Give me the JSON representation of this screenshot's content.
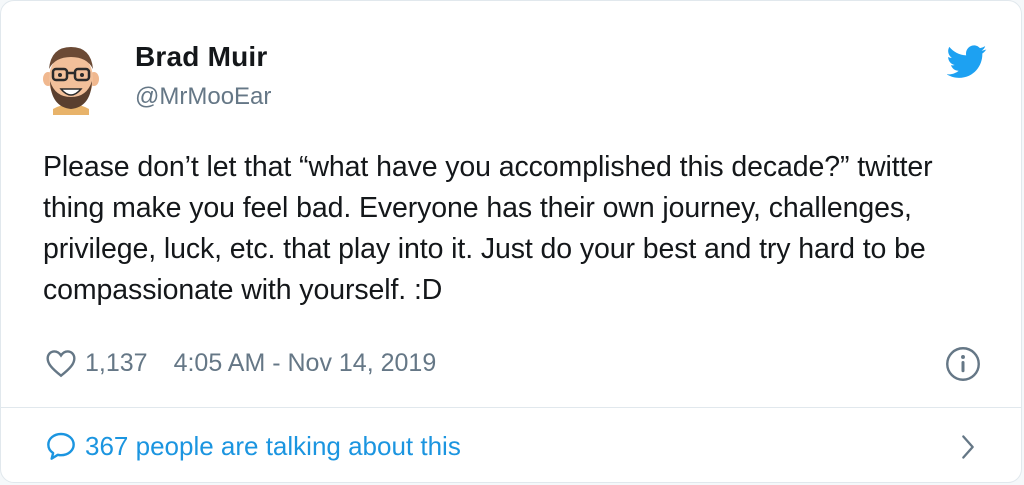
{
  "tweet": {
    "author": {
      "name": "Brad Muir",
      "handle": "@MrMooEar",
      "avatar_icon": "cartoon-avatar-bearded-man"
    },
    "text": "Please don’t let that “what have you accomplished this decade?” twitter thing make you feel bad. Everyone has their own journey, challenges, privilege, luck, etc. that play into it. Just do your best and try hard to be compassionate with yourself. :D",
    "likes": "1,137",
    "timestamp": "4:05 AM - Nov 14, 2019",
    "conversation": "367 people are talking about this"
  },
  "icons": {
    "brand": "twitter-bird-icon",
    "like": "heart-icon",
    "info": "info-icon",
    "reply": "speech-bubble-icon",
    "chevron": "chevron-right-icon"
  },
  "colors": {
    "twitter_blue": "#1da1f2",
    "link_blue": "#1b95e0",
    "text_primary": "#14171a",
    "text_secondary": "#657786"
  }
}
